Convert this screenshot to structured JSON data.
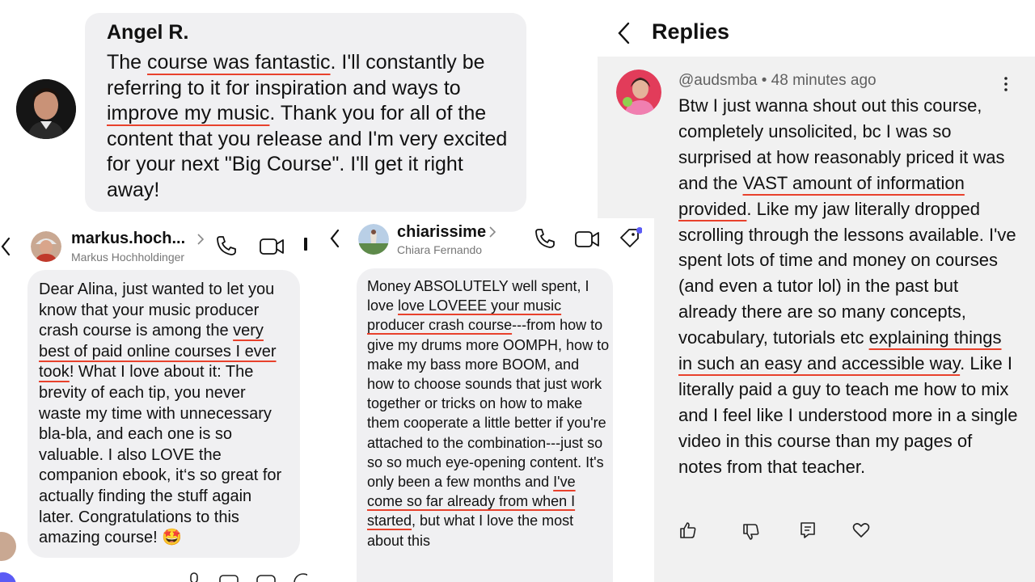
{
  "review1": {
    "author": "Angel R.",
    "t1": "The ",
    "u1": "course was fantastic",
    "t2": ". I'll constantly be referring to it for inspiration and ways to ",
    "u2": "improve my music",
    "t3": ". Thank you for all of the content that you release and I'm very excited for your next \"Big Course\". I'll get it right away!"
  },
  "chat1": {
    "username": "markus.hoch...",
    "fullname": "Markus Hochholdinger",
    "t1": "Dear Alina, just wanted to let you know that your music producer crash course is among the ",
    "u1": "very best of paid online courses I ever took",
    "t2": "! What I love about it: The brevity of each tip, you never waste my time with unnecessary bla-bla, and each one is so valuable. I also LOVE the companion ebook, it‘s so great for actually finding the stuff again later. Congratulations to this amazing course! 🤩"
  },
  "chat2": {
    "username": "chiarissime",
    "fullname": "Chiara Fernando",
    "t1": "Money ABSOLUTELY well spent, I love ",
    "u1": "love LOVEEE your music producer crash course",
    "t2": "---from how to give my drums more OOMPH, how to make my bass more BOOM, and how to choose sounds that just work together or tricks on how to make them cooperate a little better if you're attached to the combination---just so so so much eye-opening content. It's only been a few months and ",
    "u2": "I've come so far already from when I started",
    "t3": ", but what I love the most about this"
  },
  "replies": {
    "header": "Replies",
    "handle": "@audsmba",
    "time": "48 minutes ago",
    "t1": "Btw I just wanna shout out this course, completely unsolicited, bc I was so surprised at how reasonably priced it was and the ",
    "u1": "VAST amount of information provided",
    "t2": ". Like my jaw literally dropped scrolling through the lessons available. I've spent lots of time and money on courses (and even a tutor lol) in the past but already there are so many concepts, vocabulary, tutorials etc ",
    "u2": "explaining things in such an easy and accessible way",
    "t3": ". Like I literally paid a guy to teach me how to mix and I feel like I understood more in a single video in this course than my pages of notes from that teacher."
  },
  "colors": {
    "underline": "#e8412c",
    "bubble": "#f0f0f2",
    "accent": "#5b5bf5"
  }
}
